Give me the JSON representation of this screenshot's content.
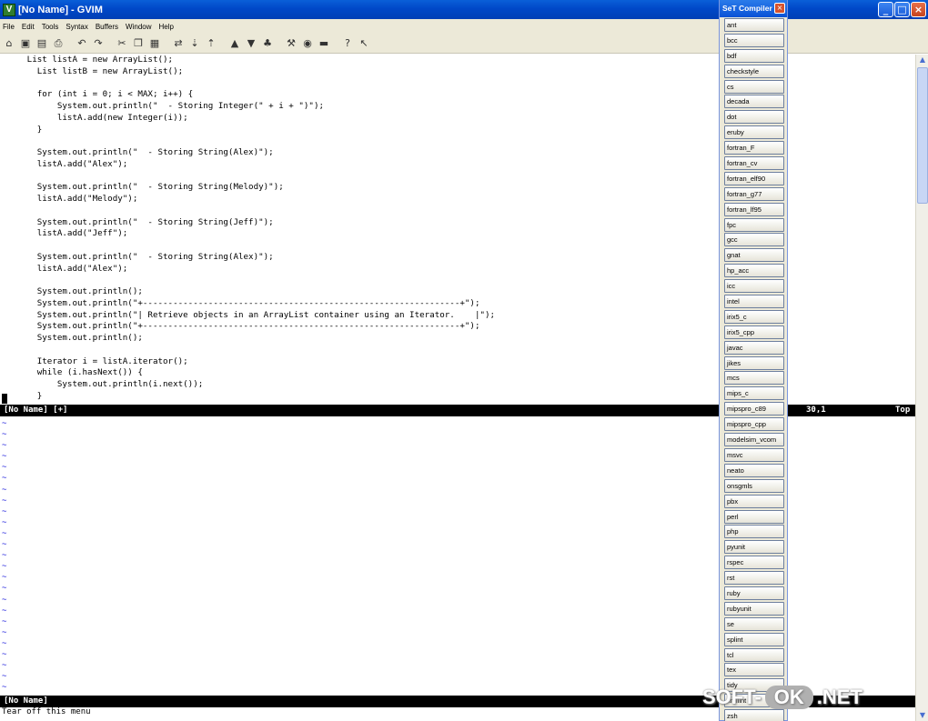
{
  "window": {
    "title": "[No Name] - GVIM",
    "app_icon": "gvim-icon"
  },
  "menubar": [
    "File",
    "Edit",
    "Tools",
    "Syntax",
    "Buffers",
    "Window",
    "Help"
  ],
  "toolbar_icons": [
    "open-icon",
    "save-icon",
    "save-all-icon",
    "print-icon",
    "undo-icon",
    "redo-icon",
    "cut-icon",
    "copy-icon",
    "paste-icon",
    "replace-icon",
    "find-next-icon",
    "find-prev-icon",
    "load-session-icon",
    "save-session-icon",
    "run-script-icon",
    "make-icon",
    "shell-icon",
    "tags-icon",
    "help-icon",
    "find-help-icon"
  ],
  "editor": {
    "lines": [
      "     List listA = new ArrayList();",
      "       List listB = new ArrayList();",
      "",
      "       for (int i = 0; i < MAX; i++) {",
      "           System.out.println(\"  - Storing Integer(\" + i + \")\");",
      "           listA.add(new Integer(i));",
      "       }",
      "",
      "       System.out.println(\"  - Storing String(Alex)\");",
      "       listA.add(\"Alex\");",
      "",
      "       System.out.println(\"  - Storing String(Melody)\");",
      "       listA.add(\"Melody\");",
      "",
      "       System.out.println(\"  - Storing String(Jeff)\");",
      "       listA.add(\"Jeff\");",
      "",
      "       System.out.println(\"  - Storing String(Alex)\");",
      "       listA.add(\"Alex\");",
      "",
      "       System.out.println();",
      "       System.out.println(\"+---------------------------------------------------------------+\");",
      "       System.out.println(\"| Retrieve objects in an ArrayList container using an Iterator.    |\");",
      "       System.out.println(\"+---------------------------------------------------------------+\");",
      "       System.out.println();",
      "",
      "       Iterator i = listA.iterator();",
      "       while (i.hasNext()) {",
      "           System.out.println(i.next());",
      "       }"
    ],
    "status_top": {
      "name": "[No Name] [+]",
      "position": "30,1",
      "scroll": "Top"
    },
    "status_bottom": {
      "name": "[No Name]"
    },
    "command_line": "Tear off this menu",
    "tilde": "~"
  },
  "compiler_panel": {
    "title": "SeT Compiler",
    "items": [
      "ant",
      "bcc",
      "bdf",
      "checkstyle",
      "cs",
      "decada",
      "dot",
      "eruby",
      "fortran_F",
      "fortran_cv",
      "fortran_elf90",
      "fortran_g77",
      "fortran_lf95",
      "fpc",
      "gcc",
      "gnat",
      "hp_acc",
      "icc",
      "intel",
      "irix5_c",
      "irix5_cpp",
      "javac",
      "jikes",
      "mcs",
      "mips_c",
      "mipspro_c89",
      "mipspro_cpp",
      "modelsim_vcom",
      "msvc",
      "neato",
      "onsgmls",
      "pbx",
      "perl",
      "php",
      "pyunit",
      "rspec",
      "rst",
      "ruby",
      "rubyunit",
      "se",
      "splint",
      "tcl",
      "tex",
      "tidy",
      "xmllint",
      "zsh"
    ]
  },
  "watermark": {
    "left": "SOFT-",
    "ok": "OK",
    "right": ".NET"
  }
}
